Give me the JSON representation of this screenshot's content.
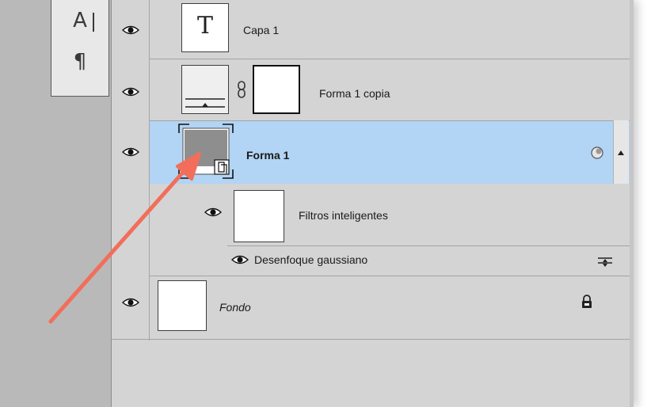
{
  "tools": [
    {
      "name": "character-tool",
      "glyph": "A"
    },
    {
      "name": "paragraph-tool",
      "glyph": "¶"
    }
  ],
  "layers": [
    {
      "name": "Capa 1",
      "thumb_glyph": "T"
    },
    {
      "name": "Forma 1 copia"
    },
    {
      "name": "Forma 1"
    },
    {
      "name": "Filtros inteligentes"
    },
    {
      "name": "Desenfoque gaussiano"
    },
    {
      "name": "Fondo"
    }
  ],
  "colors": {
    "selection": "#b2d4f5",
    "annotation_arrow": "#f26e5b"
  },
  "icons": {
    "visibility": "eye-icon",
    "link": "chain-link-icon",
    "smart_object": "smart-object-badge-icon",
    "smart_filter": "smart-filter-icon",
    "filter_options": "blending-options-icon",
    "lock": "lock-icon",
    "collapse": "triangle-up-icon"
  }
}
